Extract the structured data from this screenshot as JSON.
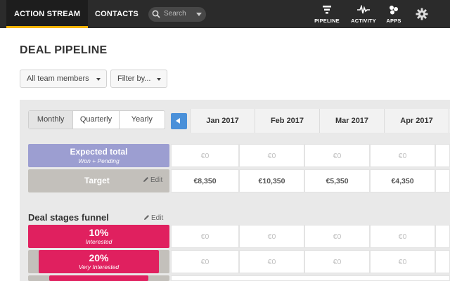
{
  "nav": {
    "tabs": [
      "ACTION STREAM",
      "CONTACTS"
    ],
    "search_placeholder": "Search",
    "icons": [
      {
        "label": "PIPELINE",
        "icon": "pipeline-icon"
      },
      {
        "label": "ACTIVITY",
        "icon": "activity-icon"
      },
      {
        "label": "APPS",
        "icon": "apps-icon"
      }
    ],
    "settings_icon": "gear-icon"
  },
  "page": {
    "title": "DEAL PIPELINE",
    "filters": [
      "All team members",
      "Filter by..."
    ]
  },
  "period": {
    "options": [
      "Monthly",
      "Quarterly",
      "Yearly"
    ],
    "selected": "Monthly"
  },
  "months": [
    "Jan 2017",
    "Feb 2017",
    "Mar 2017",
    "Apr 2017"
  ],
  "expected": {
    "label": "Expected total",
    "sublabel": "Won + Pending",
    "values": [
      "€0",
      "€0",
      "€0",
      "€0"
    ]
  },
  "target": {
    "label": "Target",
    "edit_label": "Edit",
    "values": [
      "€8,350",
      "€10,350",
      "€5,350",
      "€4,350"
    ]
  },
  "funnel": {
    "title": "Deal stages funnel",
    "edit_label": "Edit",
    "stages": [
      {
        "pct": "10%",
        "name": "Interested",
        "values": [
          "€0",
          "€0",
          "€0",
          "€0"
        ]
      },
      {
        "pct": "20%",
        "name": "Very Interested",
        "values": [
          "€0",
          "€0",
          "€0",
          "€0"
        ]
      }
    ]
  },
  "colors": {
    "nav_bg": "#2b2b2b",
    "active_tab_accent": "#f5b400",
    "expected_bg": "#9c9ed1",
    "target_bg": "#c3c0bb",
    "stage_bg": "#e0205f",
    "arrow_btn": "#4a90d9"
  }
}
